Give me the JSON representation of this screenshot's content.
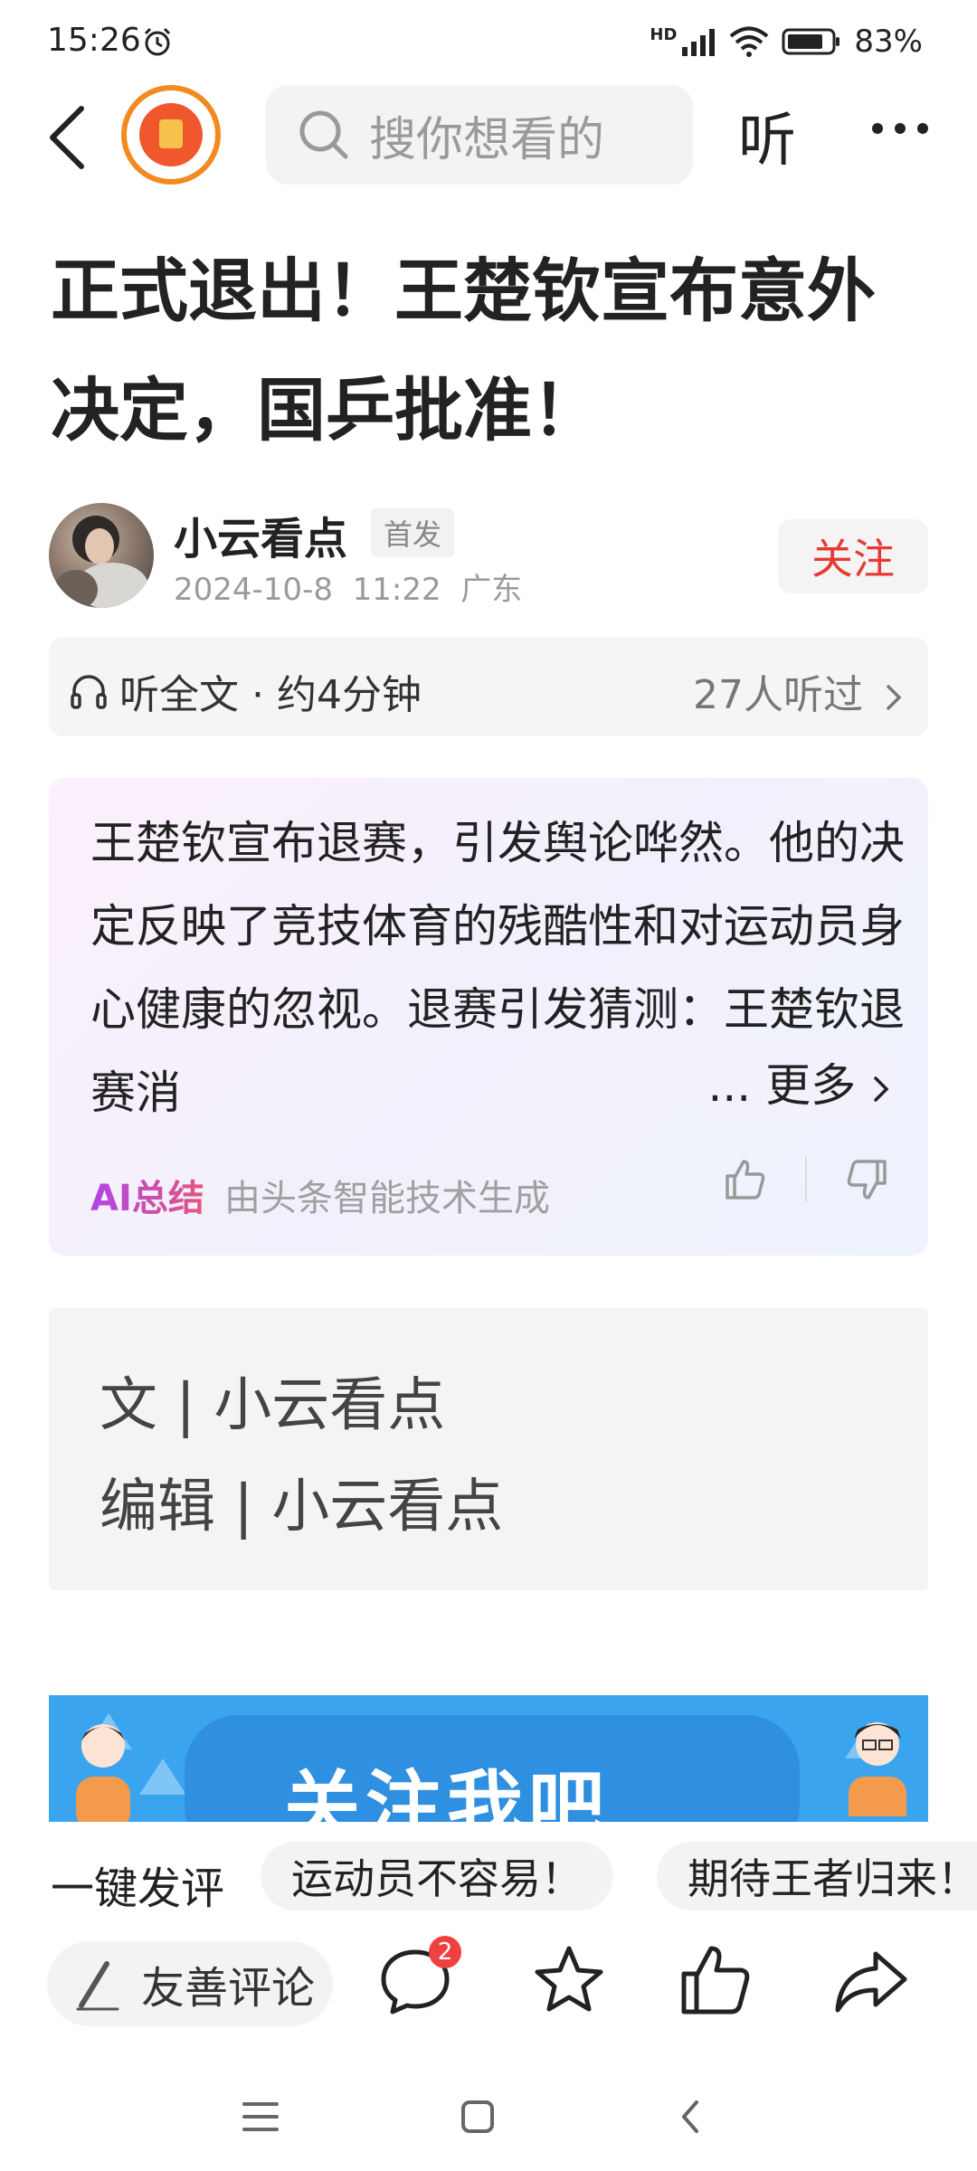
{
  "status_bar": {
    "time": "15:26",
    "network": "HD",
    "battery": "83%"
  },
  "top_nav": {
    "search_placeholder": "搜你想看的",
    "listen_label": "听"
  },
  "article": {
    "title": "正式退出！王楚钦宣布意外决定，国乒批准！",
    "author": {
      "name": "小云看点",
      "badge": "首发",
      "date": "2024-10-8",
      "time": "11:22",
      "location": "广东",
      "follow_label": "关注"
    },
    "listen_bar": {
      "label": "听全文 · 约4分钟",
      "count": "27人听过"
    },
    "ai_summary": {
      "text": "王楚钦宣布退赛，引发舆论哗然。他的决定反映了竞技体育的残酷性和对运动员身心健康的忽视。退赛引发猜测：王楚钦退赛消",
      "ellipsis": "...",
      "more_label": "更多",
      "label": "AI总结",
      "note": "由头条智能技术生成"
    },
    "credits": {
      "writer": "文 | 小云看点",
      "editor": "编辑 | 小云看点"
    },
    "banner_text": "关注我吧"
  },
  "quick_comment": {
    "label": "一键发评",
    "chips": [
      "运动员不容易！",
      "期待王者归来！"
    ]
  },
  "action_bar": {
    "comment_placeholder": "友善评论",
    "comment_count": "2"
  },
  "colors": {
    "accent_red": "#e63a32",
    "brand_orange": "#f0572d",
    "banner_blue": "#3aa4ef"
  },
  "icons": [
    "alarm-icon",
    "signal-icon",
    "wifi-icon",
    "battery-icon",
    "back-icon",
    "search-icon",
    "more-icon",
    "headphone-icon",
    "thumbs-up-icon",
    "thumbs-down-icon",
    "pen-icon",
    "comment-icon",
    "star-icon",
    "like-icon",
    "share-icon",
    "menu-nav-icon",
    "home-nav-icon",
    "back-nav-icon"
  ]
}
